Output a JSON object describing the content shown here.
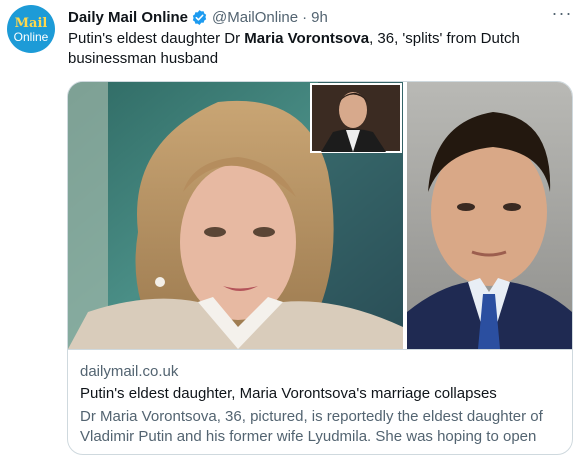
{
  "avatar": {
    "line1": "Mail",
    "line2": "Online"
  },
  "header": {
    "name": "Daily Mail Online",
    "handle": "@MailOnline",
    "separator": "·",
    "time": "9h",
    "more": "···"
  },
  "tweet": {
    "text_before": "Putin's eldest daughter Dr ",
    "text_bold": "Maria Vorontsova",
    "text_after": ", 36, 'splits' from Dutch businessman husband"
  },
  "card": {
    "domain": "dailymail.co.uk",
    "title": "Putin's eldest daughter, Maria Vorontsova's marriage collapses",
    "description": "Dr Maria Vorontsova, 36, pictured, is reportedly the eldest daughter of Vladimir Putin and his former wife Lyudmila. She was hoping to open a..."
  },
  "colors": {
    "brand_avatar": "#1d9bd7",
    "verified": "#1d9bf0",
    "text_primary": "#0f1419",
    "text_secondary": "#536471",
    "border": "#cfd9de"
  },
  "icons": [
    "verified-badge-icon",
    "more-options-icon"
  ]
}
